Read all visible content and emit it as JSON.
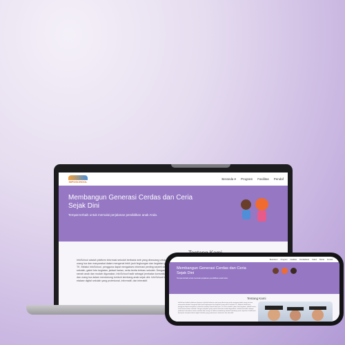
{
  "site": {
    "logo_text": "INFOSCHOOL",
    "nav": [
      "Beranda ▾",
      "Program",
      "Fasilitas",
      "Pendaf"
    ],
    "hero_title": "Membangun Generasi Cerdas dan Ceria Sejak Dini",
    "hero_subtitle": "Tempat terbaik untuk memulai perjalanan pendidikan anak Anda.",
    "about_title": "Tentang Kami",
    "about_text": "InfoSchool adalah platform informasi sekolah berbasis web yang dirancang untuk mempermudah orang tua dan masyarakat dalam mengenal lebih jauh lingkungan dan kegiatan yang ada di sekolah TK. Melalui InfoSchool, pengguna dapat mengakses informasi penting seperti data guru, visi misi sekolah, galeri foto kegiatan, jadwal harian, serta berita terbaru sekolah. Dengan tampilan yang ramah anak dan mudah digunakan, InfoSchool hadir sebagai jembatan komunikasi antara sekolah dan orang tua dalam mendukung tumbuh kembang anak sejak dini. InfoSchool bertujuan menjadi etalase digital sekolah yang profesional, informatif, dan interaktif.",
    "phone_nav": [
      "Beranda ▾",
      "Program",
      "Fasilitas",
      "Pendaftaran",
      "Galeri",
      "Berita",
      "Kontak"
    ]
  },
  "colors": {
    "hero": "#9577c4",
    "background": "#c7b3e0"
  }
}
